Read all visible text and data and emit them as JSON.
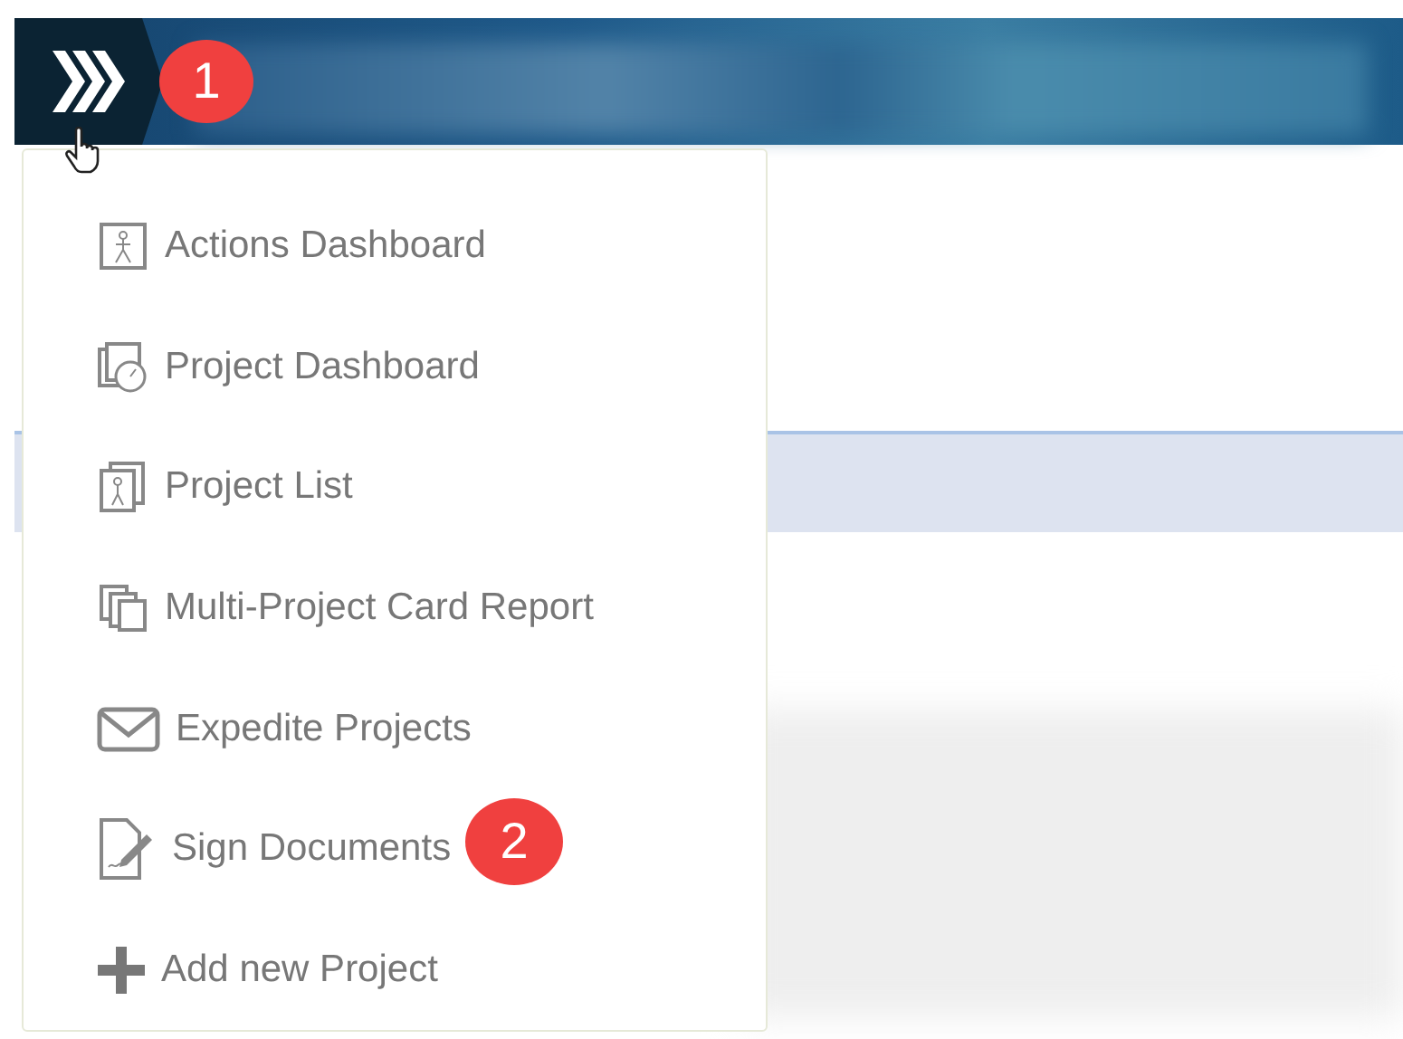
{
  "header": {
    "badge": "1"
  },
  "menu": {
    "items": [
      {
        "label": "Actions Dashboard"
      },
      {
        "label": "Project Dashboard"
      },
      {
        "label": "Project List"
      },
      {
        "label": "Multi-Project Card Report"
      },
      {
        "label": "Expedite Projects"
      },
      {
        "label": "Sign Documents",
        "badge": "2"
      },
      {
        "label": "Add new Project"
      }
    ]
  }
}
